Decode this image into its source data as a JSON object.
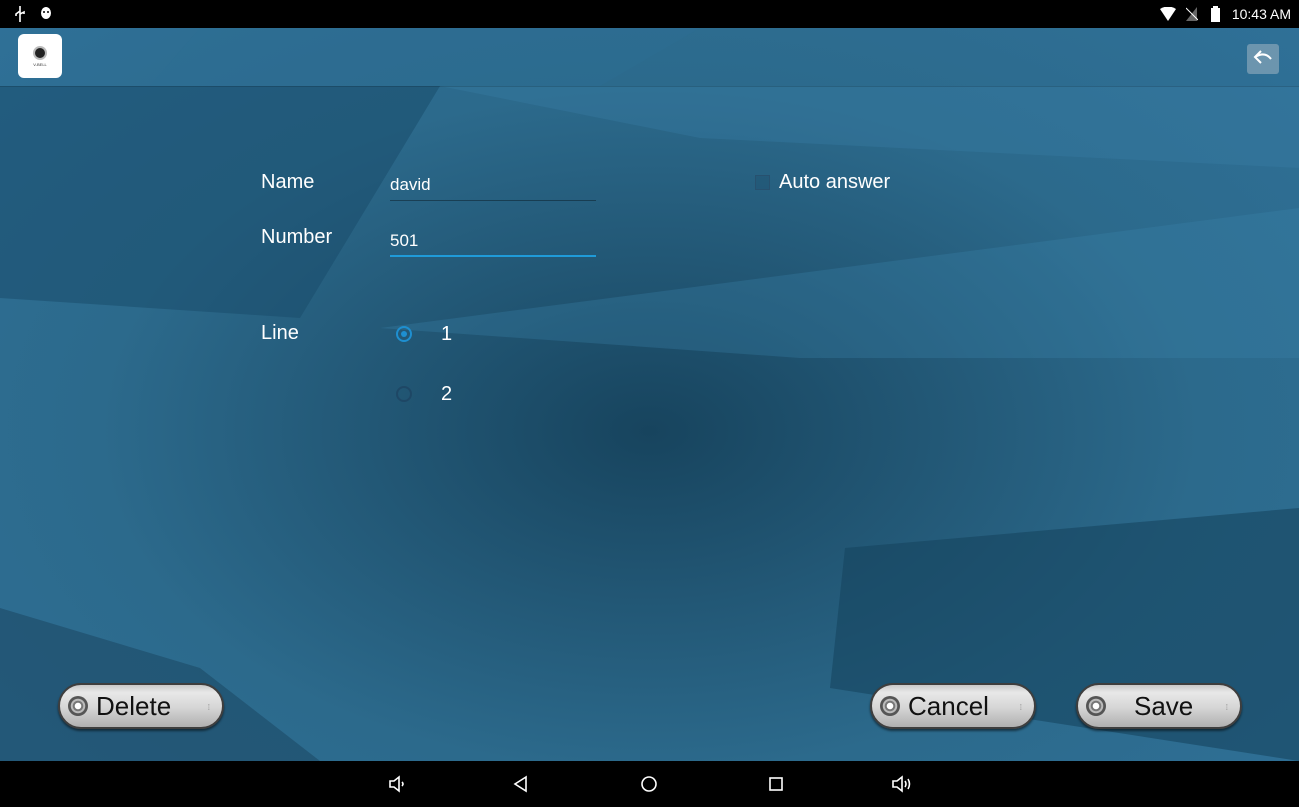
{
  "status_bar": {
    "left_icons": [
      "usb-icon",
      "android-debug-icon"
    ],
    "right_icons": [
      "wifi-icon",
      "no-sim-icon",
      "battery-icon"
    ],
    "time": "10:43 AM"
  },
  "app_bar": {
    "logo_text": "V-BELL",
    "back_icon": "reply-back-icon"
  },
  "form": {
    "name_label": "Name",
    "name_value": "david",
    "number_label": "Number",
    "number_value": "501",
    "auto_answer_label": "Auto answer",
    "auto_answer_checked": false,
    "line_label": "Line",
    "line_options": [
      {
        "label": "1",
        "checked": true
      },
      {
        "label": "2",
        "checked": false
      }
    ]
  },
  "buttons": {
    "delete": "Delete",
    "cancel": "Cancel",
    "save": "Save"
  },
  "nav_bar": {
    "icons": [
      "volume-down-icon",
      "back-icon",
      "home-icon",
      "recents-icon",
      "volume-up-icon"
    ]
  },
  "colors": {
    "accent": "#1f9bd9",
    "background": "#2c6a8c"
  }
}
